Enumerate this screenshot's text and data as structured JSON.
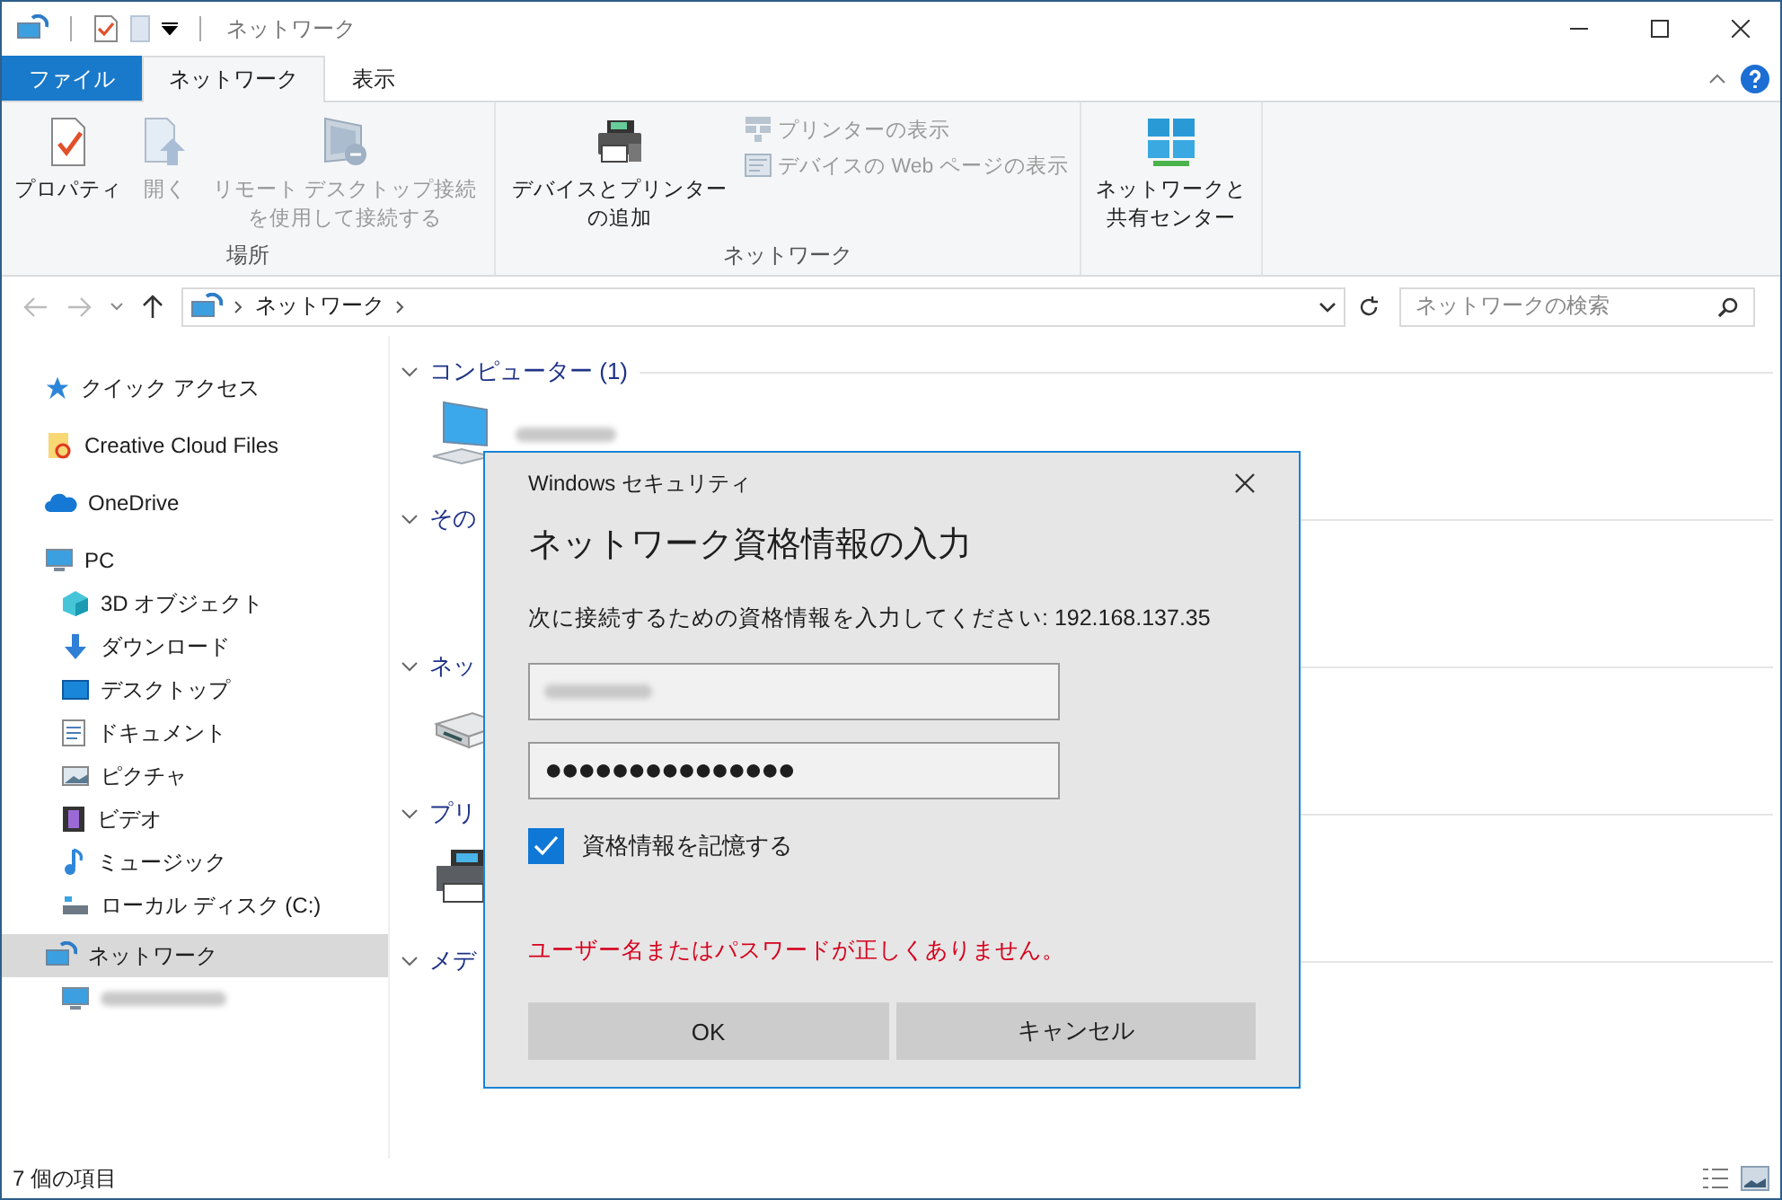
{
  "window": {
    "title": "ネットワーク"
  },
  "ribbon": {
    "tabs": [
      {
        "label": "ファイル",
        "kind": "file",
        "selected": false
      },
      {
        "label": "ネットワーク",
        "kind": "tab",
        "selected": true
      },
      {
        "label": "表示",
        "kind": "tab",
        "selected": false
      }
    ],
    "groups": [
      {
        "label": "場所",
        "commands": [
          {
            "label": "プロパティ",
            "kind": "properties",
            "disabled": false
          },
          {
            "label": "開く",
            "kind": "open",
            "disabled": true
          },
          {
            "label": "リモート デスクトップ接続を使用して接続する",
            "kind": "remote",
            "disabled": true
          }
        ]
      },
      {
        "label": "ネットワーク",
        "commands": [
          {
            "label": "デバイスとプリンターの追加",
            "kind": "addprinter",
            "disabled": false
          },
          {
            "label": "プリンターの表示",
            "kind": "printers",
            "disabled": true
          },
          {
            "label": "デバイスの Web ページの表示",
            "kind": "webpage",
            "disabled": true
          }
        ]
      },
      {
        "commands": [
          {
            "label": "ネットワークと共有センター",
            "kind": "netcenter",
            "disabled": false
          }
        ]
      }
    ]
  },
  "address": {
    "path": [
      "ネットワーク"
    ],
    "search_placeholder": "ネットワークの検索"
  },
  "sidebar": {
    "items": [
      {
        "label": "クイック アクセス",
        "kind": "star",
        "selected": false
      },
      {
        "label": "Creative Cloud Files",
        "kind": "cc",
        "selected": false
      },
      {
        "label": "OneDrive",
        "kind": "cloud",
        "selected": false
      },
      {
        "label": "PC",
        "kind": "pc",
        "selected": false,
        "children": [
          {
            "label": "3D オブジェクト",
            "kind": "cube",
            "selected": false
          },
          {
            "label": "ダウンロード",
            "kind": "download",
            "selected": false
          },
          {
            "label": "デスクトップ",
            "kind": "desktop",
            "selected": false
          },
          {
            "label": "ドキュメント",
            "kind": "document",
            "selected": false
          },
          {
            "label": "ピクチャ",
            "kind": "picture",
            "selected": false
          },
          {
            "label": "ビデオ",
            "kind": "video",
            "selected": false
          },
          {
            "label": "ミュージック",
            "kind": "music",
            "selected": false
          },
          {
            "label": "ローカル ディスク (C:)",
            "kind": "disk",
            "selected": false
          }
        ]
      },
      {
        "label": "ネットワーク",
        "kind": "network",
        "selected": true,
        "children": [
          {
            "kind": "pc",
            "redacted": true,
            "selected": false
          }
        ]
      }
    ]
  },
  "content": {
    "groups": [
      {
        "title": "コンピューター (1)",
        "items": [
          {
            "kind": "computer",
            "redacted": true
          }
        ]
      },
      {
        "title": "その"
      },
      {
        "title": "ネッ",
        "items": [
          {
            "kind": "router"
          }
        ]
      },
      {
        "title": "プリ",
        "items": [
          {
            "kind": "printer"
          }
        ]
      },
      {
        "title": "メデ"
      }
    ]
  },
  "dialog": {
    "title": "Windows セキュリティ",
    "heading": "ネットワーク資格情報の入力",
    "prompt": "次に接続するための資格情報を入力してください: 192.168.137.35",
    "username": {
      "redacted": true
    },
    "password": {
      "value": "●●●●●●●●●●●●●●●"
    },
    "remember": {
      "label": "資格情報を記憶する",
      "checked": true
    },
    "error": "ユーザー名またはパスワードが正しくありません。",
    "buttons": [
      "OK",
      "キャンセル"
    ]
  },
  "status_bar": {
    "count": "7 個の項目"
  }
}
